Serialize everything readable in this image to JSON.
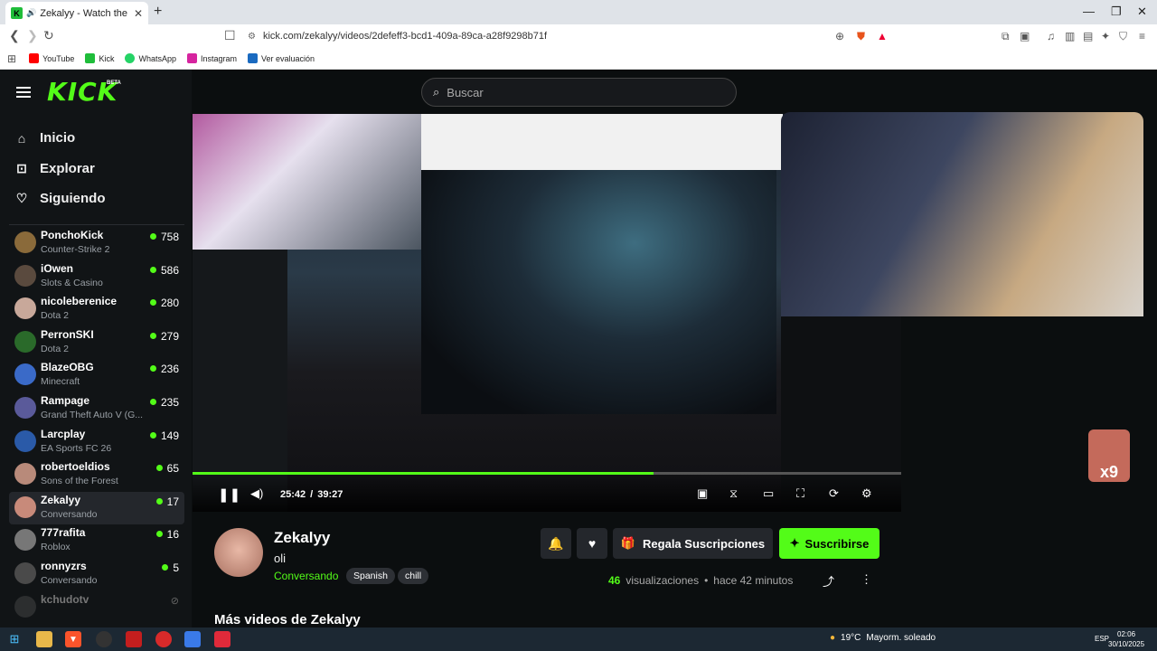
{
  "browser": {
    "tab_title": "Zekalyy - Watch the VOD on",
    "url": "kick.com/zekalyy/videos/2defeff3-bcd1-409a-89ca-a28f9298b71f",
    "bookmarks": [
      "YouTube",
      "Kick",
      "WhatsApp",
      "Instagram",
      "Ver evaluación"
    ]
  },
  "header": {
    "logo": "KICK",
    "beta": "BETA",
    "search_placeholder": "Buscar"
  },
  "sidebar": {
    "nav": [
      {
        "label": "Inicio",
        "icon": "home-icon"
      },
      {
        "label": "Explorar",
        "icon": "compass-icon"
      },
      {
        "label": "Siguiendo",
        "icon": "heart-icon"
      }
    ],
    "channels": [
      {
        "name": "PonchoKick",
        "category": "Counter-Strike 2",
        "viewers": "758",
        "color": "#8a6a3a"
      },
      {
        "name": "iOwen",
        "category": "Slots & Casino",
        "viewers": "586",
        "color": "#5a4a3e"
      },
      {
        "name": "nicoleberenice",
        "category": "Dota 2",
        "viewers": "280",
        "color": "#c8a89a"
      },
      {
        "name": "PerronSKI",
        "category": "Dota 2",
        "viewers": "279",
        "color": "#2a6a2a"
      },
      {
        "name": "BlazeOBG",
        "category": "Minecraft",
        "viewers": "236",
        "color": "#3a6ac8"
      },
      {
        "name": "Rampage",
        "category": "Grand Theft Auto V (G...",
        "viewers": "235",
        "color": "#5a5a9a"
      },
      {
        "name": "Larcplay",
        "category": "EA Sports FC 26",
        "viewers": "149",
        "color": "#2a5aa8"
      },
      {
        "name": "robertoeldios",
        "category": "Sons of the Forest",
        "viewers": "65",
        "color": "#b88a7a"
      },
      {
        "name": "Zekalyy",
        "category": "Conversando",
        "viewers": "17",
        "color": "#c88a7a"
      },
      {
        "name": "777rafita",
        "category": "Roblox",
        "viewers": "16",
        "color": "#777"
      },
      {
        "name": "ronnyzrs",
        "category": "Conversando",
        "viewers": "5",
        "color": "#4a4a4a"
      },
      {
        "name": "kchudotv",
        "category": "",
        "viewers": "",
        "color": "#555"
      }
    ]
  },
  "player": {
    "current_time": "25:42",
    "separator": "/",
    "duration": "39:27",
    "progress": 0.651
  },
  "channel": {
    "name": "Zekalyy",
    "title": "oli",
    "category": "Conversando",
    "tags": [
      "Spanish",
      "chill"
    ],
    "gift_label": "Regala Suscripciones",
    "subscribe_label": "Suscribirse",
    "views_count": "46",
    "views_label": "visualizaciones",
    "dot": "•",
    "time_ago": "hace 42 minutos"
  },
  "more_videos": "Más videos de Zekalyy",
  "overlay": {
    "multiplier": "x9"
  },
  "taskbar": {
    "temperature": "19°C",
    "weather": "Mayorm. soleado",
    "lang": "ESP",
    "time": "02:06",
    "date": "30/10/2025"
  },
  "colors": {
    "accent": "#53fc18",
    "bg": "#0b0e0f",
    "sidebar": "#111416"
  }
}
